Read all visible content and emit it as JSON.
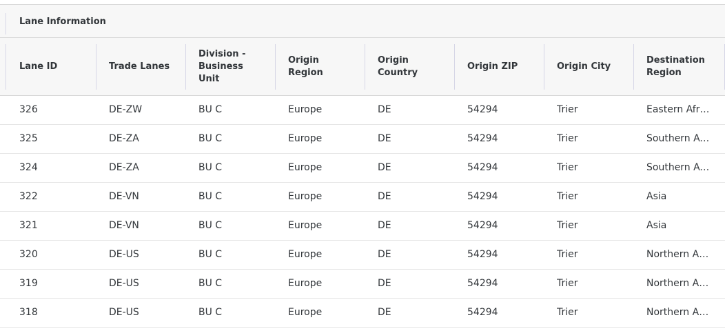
{
  "group": {
    "title": "Lane Information"
  },
  "columns": [
    {
      "key": "lane_id",
      "label": "Lane ID"
    },
    {
      "key": "trade_lanes",
      "label": "Trade Lanes"
    },
    {
      "key": "division",
      "label": "Division - Business Unit"
    },
    {
      "key": "origin_region",
      "label": "Origin Region"
    },
    {
      "key": "origin_country",
      "label": "Origin Country"
    },
    {
      "key": "origin_zip",
      "label": "Origin ZIP"
    },
    {
      "key": "origin_city",
      "label": "Origin City"
    },
    {
      "key": "destination_region",
      "label": "Destination Region"
    }
  ],
  "rows": [
    [
      "326",
      "DE-ZW",
      "BU C",
      "Europe",
      "DE",
      "54294",
      "Trier",
      "Eastern Africa"
    ],
    [
      "325",
      "DE-ZA",
      "BU C",
      "Europe",
      "DE",
      "54294",
      "Trier",
      "Southern Africa"
    ],
    [
      "324",
      "DE-ZA",
      "BU C",
      "Europe",
      "DE",
      "54294",
      "Trier",
      "Southern Africa"
    ],
    [
      "322",
      "DE-VN",
      "BU C",
      "Europe",
      "DE",
      "54294",
      "Trier",
      "Asia"
    ],
    [
      "321",
      "DE-VN",
      "BU C",
      "Europe",
      "DE",
      "54294",
      "Trier",
      "Asia"
    ],
    [
      "320",
      "DE-US",
      "BU C",
      "Europe",
      "DE",
      "54294",
      "Trier",
      "Northern America"
    ],
    [
      "319",
      "DE-US",
      "BU C",
      "Europe",
      "DE",
      "54294",
      "Trier",
      "Northern America"
    ],
    [
      "318",
      "DE-US",
      "BU C",
      "Europe",
      "DE",
      "54294",
      "Trier",
      "Northern America"
    ]
  ]
}
